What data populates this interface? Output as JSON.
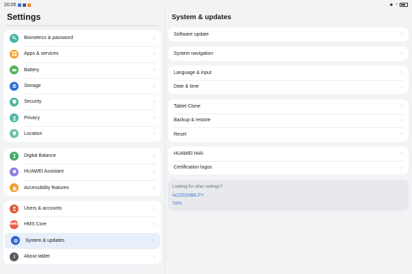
{
  "status_bar": {
    "time": "20:05"
  },
  "left": {
    "title": "Settings",
    "groups": [
      [
        {
          "label": "Biometrics & password",
          "icon": "key-icon",
          "color": "#3fb5a5"
        },
        {
          "label": "Apps & services",
          "icon": "apps-icon",
          "color": "#f2a533"
        },
        {
          "label": "Battery",
          "icon": "battery-icon",
          "color": "#54b456"
        },
        {
          "label": "Storage",
          "icon": "storage-icon",
          "color": "#2e6fd8"
        },
        {
          "label": "Security",
          "icon": "shield-icon",
          "color": "#4ab8a0"
        },
        {
          "label": "Privacy",
          "icon": "privacy-icon",
          "color": "#4fb9a8"
        },
        {
          "label": "Location",
          "icon": "location-icon",
          "color": "#6cc3a0"
        }
      ],
      [
        {
          "label": "Digital Balance",
          "icon": "hourglass-icon",
          "color": "#48a96a"
        },
        {
          "label": "HUAWEI Assistant",
          "icon": "assistant-icon",
          "color": "#8f7fe0"
        },
        {
          "label": "Accessibility features",
          "icon": "hand-icon",
          "color": "#f0a03a"
        }
      ],
      [
        {
          "label": "Users & accounts",
          "icon": "user-icon",
          "color": "#e25c3a"
        },
        {
          "label": "HMS Core",
          "icon": "hms-icon",
          "color": "#e85a4a",
          "badge": "HMS"
        },
        {
          "label": "System & updates",
          "icon": "system-icon",
          "color": "#2f64d0",
          "selected": true
        },
        {
          "label": "About tablet",
          "icon": "info-icon",
          "color": "#555a60"
        }
      ]
    ]
  },
  "right": {
    "title": "System & updates",
    "groups": [
      [
        "Software update"
      ],
      [
        "System navigation"
      ],
      [
        "Language & input",
        "Date & time"
      ],
      [
        "Tablet Clone",
        "Backup & restore",
        "Reset"
      ],
      [
        "HUAWEI HiAI",
        "Certification logos"
      ]
    ],
    "other": {
      "question": "Looking for other settings?",
      "links": [
        "ACCESSIBILITY",
        "TIPS"
      ]
    }
  }
}
